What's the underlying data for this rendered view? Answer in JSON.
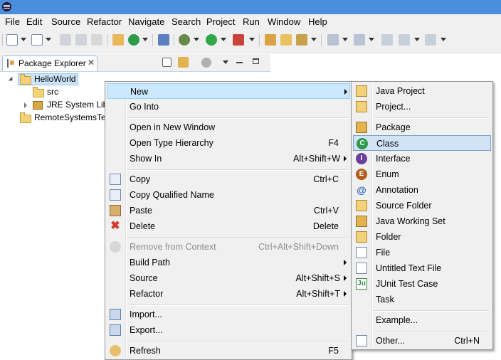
{
  "menubar": [
    "File",
    "Edit",
    "Source",
    "Refactor",
    "Navigate",
    "Search",
    "Project",
    "Run",
    "Window",
    "Help"
  ],
  "view": {
    "tab_label": "Package Explorer",
    "close_glyph": "✕"
  },
  "tree": {
    "project": "HelloWorld",
    "src": "src",
    "jre": "JRE System Libr",
    "remote": "RemoteSystemsTe"
  },
  "context_menu": [
    {
      "label": "New",
      "accel": "",
      "submenu": true,
      "highlighted": true,
      "icon": ""
    },
    {
      "label": "Go Into",
      "accel": "",
      "icon": ""
    },
    {
      "label": "Open in New Window",
      "accel": "",
      "icon": ""
    },
    {
      "label": "Open Type Hierarchy",
      "accel": "F4",
      "icon": ""
    },
    {
      "label": "Show In",
      "accel": "Alt+Shift+W",
      "submenu": true,
      "icon": ""
    },
    {
      "label": "Copy",
      "accel": "Ctrl+C",
      "icon": "copy-icon"
    },
    {
      "label": "Copy Qualified Name",
      "accel": "",
      "icon": "copy-qualified-name-icon"
    },
    {
      "label": "Paste",
      "accel": "Ctrl+V",
      "icon": "paste-icon"
    },
    {
      "label": "Delete",
      "accel": "Delete",
      "icon": "delete-icon"
    },
    {
      "label": "Remove from Context",
      "accel": "Ctrl+Alt+Shift+Down",
      "disabled": true,
      "icon": "remove-context-icon"
    },
    {
      "label": "Build Path",
      "accel": "",
      "submenu": true,
      "icon": ""
    },
    {
      "label": "Source",
      "accel": "Alt+Shift+S",
      "submenu": true,
      "icon": ""
    },
    {
      "label": "Refactor",
      "accel": "Alt+Shift+T",
      "submenu": true,
      "icon": ""
    },
    {
      "label": "Import...",
      "accel": "",
      "icon": "import-icon"
    },
    {
      "label": "Export...",
      "accel": "",
      "icon": "export-icon"
    },
    {
      "label": "Refresh",
      "accel": "F5",
      "icon": "refresh-icon"
    }
  ],
  "new_submenu": [
    {
      "label": "Java Project",
      "accel": "",
      "icon": "java-project-icon"
    },
    {
      "label": "Project...",
      "accel": "",
      "icon": "project-icon"
    },
    {
      "label": "Package",
      "accel": "",
      "icon": "package-icon"
    },
    {
      "label": "Class",
      "accel": "",
      "icon": "class-icon",
      "highlighted": true
    },
    {
      "label": "Interface",
      "accel": "",
      "icon": "interface-icon"
    },
    {
      "label": "Enum",
      "accel": "",
      "icon": "enum-icon"
    },
    {
      "label": "Annotation",
      "accel": "",
      "icon": "annotation-icon"
    },
    {
      "label": "Source Folder",
      "accel": "",
      "icon": "source-folder-icon"
    },
    {
      "label": "Java Working Set",
      "accel": "",
      "icon": "working-set-icon"
    },
    {
      "label": "Folder",
      "accel": "",
      "icon": "folder-icon"
    },
    {
      "label": "File",
      "accel": "",
      "icon": "file-icon"
    },
    {
      "label": "Untitled Text File",
      "accel": "",
      "icon": "untitled-text-file-icon"
    },
    {
      "label": "JUnit Test Case",
      "accel": "",
      "icon": "junit-icon"
    },
    {
      "label": "Task",
      "accel": "",
      "icon": "task-icon"
    },
    {
      "label": "Example...",
      "accel": "",
      "icon": "example-icon"
    },
    {
      "label": "Other...",
      "accel": "Ctrl+N",
      "icon": "other-icon"
    }
  ],
  "colors": {
    "titlebar": "#4a8fdc",
    "menu_bg": "#f0f0f0",
    "highlight": "#cce8ff",
    "selection": "#cce4f7",
    "class_icon": "#2f9a4b",
    "interface_icon": "#6b3fa0",
    "enum_icon": "#b25b1c",
    "delete_icon": "#d33a2b"
  }
}
